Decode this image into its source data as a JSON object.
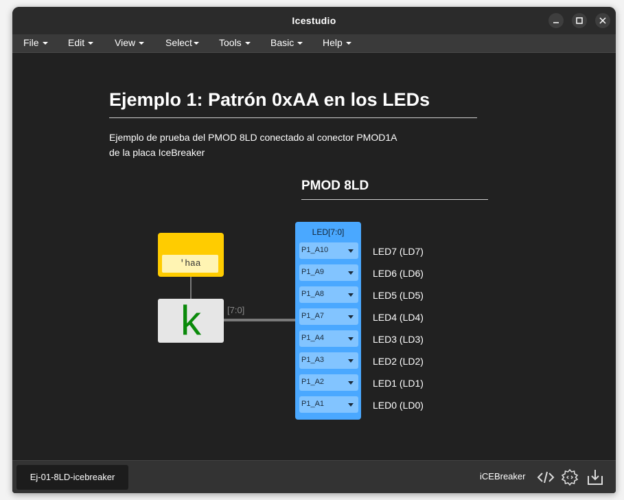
{
  "window": {
    "title": "Icestudio"
  },
  "menu": [
    {
      "label": "File"
    },
    {
      "label": "Edit"
    },
    {
      "label": "View"
    },
    {
      "label": "Select"
    },
    {
      "label": "Tools"
    },
    {
      "label": "Basic"
    },
    {
      "label": "Help"
    }
  ],
  "canvas": {
    "heading": "Ejemplo 1: Patrón 0xAA en los LEDs",
    "description_line1": "Ejemplo de prueba del PMOD 8LD conectado al conector PMOD1A",
    "description_line2": "de la placa IceBreaker",
    "pmod_heading": "PMOD 8LD",
    "constant": {
      "value": "'haa"
    },
    "k_block": {
      "label": "k",
      "color": "#0a8a0a"
    },
    "bus_label": "[7:0]",
    "led_block": {
      "title": "LED[7:0]",
      "color": "#4aa8ff",
      "pins": [
        {
          "pin": "P1_A10",
          "led": "LED7 (LD7)"
        },
        {
          "pin": "P1_A9",
          "led": "LED6 (LD6)"
        },
        {
          "pin": "P1_A8",
          "led": "LED5 (LD5)"
        },
        {
          "pin": "P1_A7",
          "led": "LED4 (LD4)"
        },
        {
          "pin": "P1_A4",
          "led": "LED3 (LD3)"
        },
        {
          "pin": "P1_A3",
          "led": "LED2 (LD2)"
        },
        {
          "pin": "P1_A2",
          "led": "LED1 (LD1)"
        },
        {
          "pin": "P1_A1",
          "led": "LED0 (LD0)"
        }
      ]
    }
  },
  "statusbar": {
    "file_tab": "Ej-01-8LD-icebreaker",
    "board": "iCEBreaker",
    "icons": [
      "code-icon",
      "settings-icon",
      "download-icon"
    ]
  }
}
